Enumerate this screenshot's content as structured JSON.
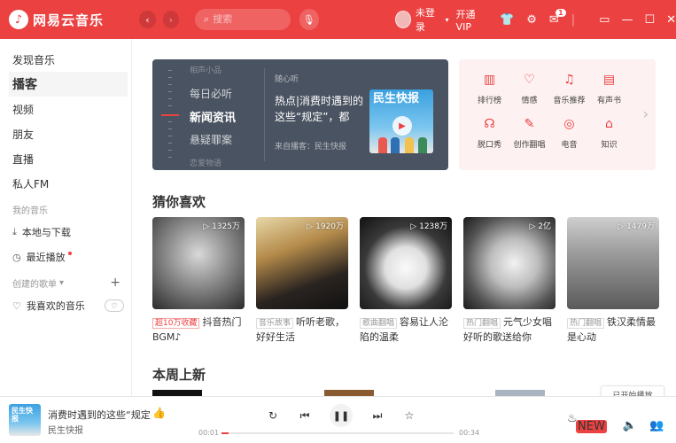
{
  "app": {
    "title": "网易云音乐"
  },
  "search": {
    "placeholder": "搜索"
  },
  "user": {
    "name": "未登录",
    "vip": "开通VIP",
    "mail_count": "1"
  },
  "sidebar": {
    "items": [
      {
        "label": "发现音乐"
      },
      {
        "label": "播客"
      },
      {
        "label": "视频"
      },
      {
        "label": "朋友"
      },
      {
        "label": "直播"
      },
      {
        "label": "私人FM"
      }
    ],
    "my_music_title": "我的音乐",
    "my_music": [
      {
        "label": "本地与下载"
      },
      {
        "label": "最近播放"
      }
    ],
    "created_title": "创建的歌单",
    "created": [
      {
        "label": "我喜欢的音乐"
      }
    ]
  },
  "banner": {
    "categories": [
      "相声小品",
      "每日必听",
      "新闻资讯",
      "悬疑罪案",
      "恋爱物语"
    ],
    "tag": "随心听",
    "title": "热点|消费时遇到的这些“规定”，都",
    "from": "来自播客：民生快报",
    "cover_text": "民生快报"
  },
  "categories": [
    {
      "label": "排行榜",
      "icon": "chart-icon",
      "glyph": "▥"
    },
    {
      "label": "情感",
      "icon": "heart-note-icon",
      "glyph": "♡"
    },
    {
      "label": "音乐推荐",
      "icon": "music-doc-icon",
      "glyph": "♫"
    },
    {
      "label": "有声书",
      "icon": "book-icon",
      "glyph": "▤"
    },
    {
      "label": "脱口秀",
      "icon": "mic-icon",
      "glyph": "☊"
    },
    {
      "label": "创作翻唱",
      "icon": "pen-icon",
      "glyph": "✎"
    },
    {
      "label": "电音",
      "icon": "disc-icon",
      "glyph": "◎"
    },
    {
      "label": "知识",
      "icon": "cap-icon",
      "glyph": "⌂"
    }
  ],
  "guess": {
    "title": "猜你喜欢",
    "cards": [
      {
        "count": "1325万",
        "tag": "超10万收藏",
        "text": "抖音热门BGM♪"
      },
      {
        "count": "1920万",
        "tag": "音乐故事",
        "text": "听听老歌，好好生活"
      },
      {
        "count": "1238万",
        "tag": "歌曲翻唱",
        "text": "容易让人沦陷的温柔"
      },
      {
        "count": "2亿",
        "tag": "热门翻唱",
        "text": "元气少女唱好听的歌送给你"
      },
      {
        "count": "1479万",
        "tag": "热门翻唱",
        "text": "铁汉柔情最是心动"
      }
    ]
  },
  "weekly": {
    "title": "本周上新"
  },
  "player": {
    "title": "消费时遇到的这些“规定",
    "artist": "民生快报",
    "time_current": "00:01",
    "time_total": "00:34",
    "progress": 0.03,
    "toast": "已开始播放"
  },
  "colors": {
    "accent": "#ec4141"
  }
}
